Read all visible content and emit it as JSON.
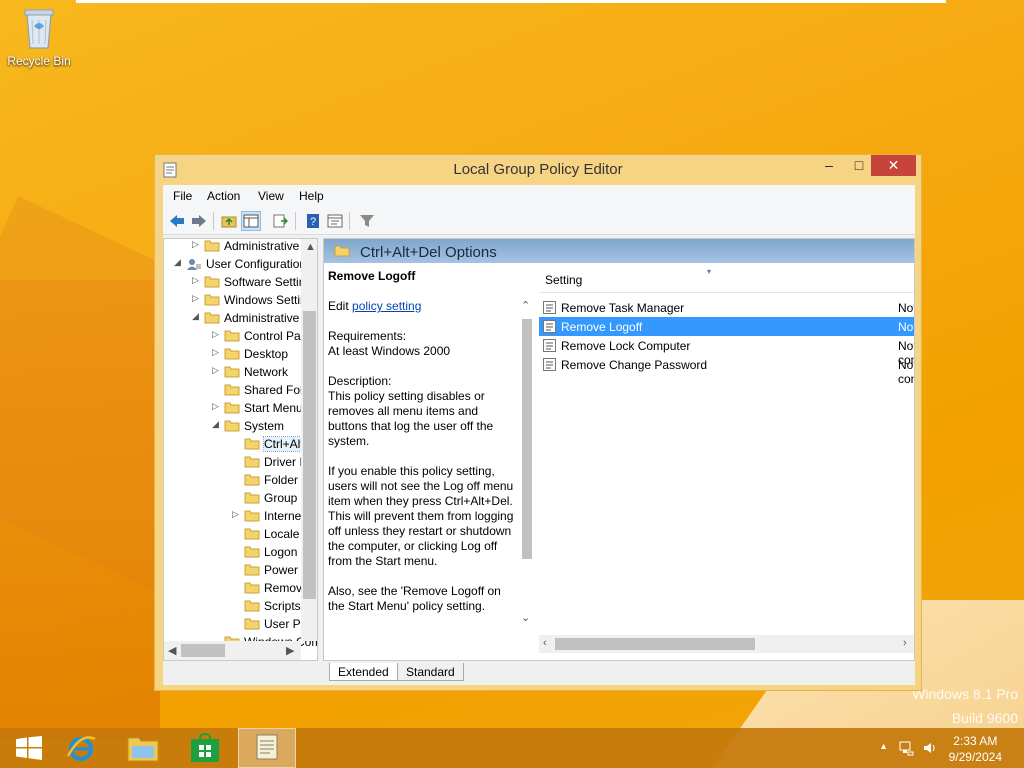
{
  "desktop": {
    "recycle_bin_label": "Recycle Bin",
    "watermark_line1": "Windows 8.1 Pro",
    "watermark_line2": "Build 9600"
  },
  "window": {
    "title": "Local Group Policy Editor",
    "controls": {
      "minimize": "–",
      "maximize": "□",
      "close": "✕"
    }
  },
  "menu": {
    "file": "File",
    "action": "Action",
    "view": "View",
    "help": "Help"
  },
  "tree": {
    "items": [
      {
        "label": "Administrative Templates",
        "arrow": "▷"
      },
      {
        "label": "User Configuration",
        "arrow": "◢"
      },
      {
        "label": "Software Settings",
        "arrow": "▷"
      },
      {
        "label": "Windows Settings",
        "arrow": "▷"
      },
      {
        "label": "Administrative Templates",
        "arrow": "◢"
      },
      {
        "label": "Control Panel",
        "arrow": "▷"
      },
      {
        "label": "Desktop",
        "arrow": "▷"
      },
      {
        "label": "Network",
        "arrow": "▷"
      },
      {
        "label": "Shared Folders",
        "arrow": ""
      },
      {
        "label": "Start Menu and Taskbar",
        "arrow": "▷"
      },
      {
        "label": "System",
        "arrow": "◢"
      },
      {
        "label": "Ctrl+Alt+Del Options",
        "arrow": ""
      },
      {
        "label": "Driver Installation",
        "arrow": ""
      },
      {
        "label": "Folder Redirection",
        "arrow": ""
      },
      {
        "label": "Group Policy",
        "arrow": ""
      },
      {
        "label": "Internet Communication Management",
        "arrow": "▷"
      },
      {
        "label": "Locale Services",
        "arrow": ""
      },
      {
        "label": "Logon",
        "arrow": ""
      },
      {
        "label": "Power Management",
        "arrow": ""
      },
      {
        "label": "Removable Storage Access",
        "arrow": ""
      },
      {
        "label": "Scripts",
        "arrow": ""
      },
      {
        "label": "User Profiles",
        "arrow": ""
      },
      {
        "label": "Windows Components",
        "arrow": ""
      }
    ]
  },
  "details": {
    "header": "Ctrl+Alt+Del Options",
    "title": "Remove Logoff",
    "edit_prefix": "Edit",
    "edit_link": "policy setting",
    "requirements_label": "Requirements:",
    "requirements_value": "At least Windows 2000",
    "description_label": "Description:",
    "description_1": "This policy setting disables or removes all menu items and buttons that log the user off the system.",
    "description_2": "If you enable this policy setting, users will not see the Log off menu item when they press Ctrl+Alt+Del. This will prevent them from logging off unless they restart or shutdown the computer, or clicking Log off from the Start menu.",
    "description_3": "Also, see the 'Remove Logoff on the Start Menu' policy setting."
  },
  "list": {
    "column_setting": "Setting",
    "rows": [
      {
        "name": "Remove Task Manager",
        "state": "Not configured"
      },
      {
        "name": "Remove Logoff",
        "state": "Not configured"
      },
      {
        "name": "Remove Lock Computer",
        "state": "Not configured"
      },
      {
        "name": "Remove Change Password",
        "state": "Not configured"
      }
    ]
  },
  "tabs": {
    "extended": "Extended",
    "standard": "Standard"
  },
  "taskbar": {
    "time": "2:33 AM",
    "date": "9/29/2024"
  }
}
